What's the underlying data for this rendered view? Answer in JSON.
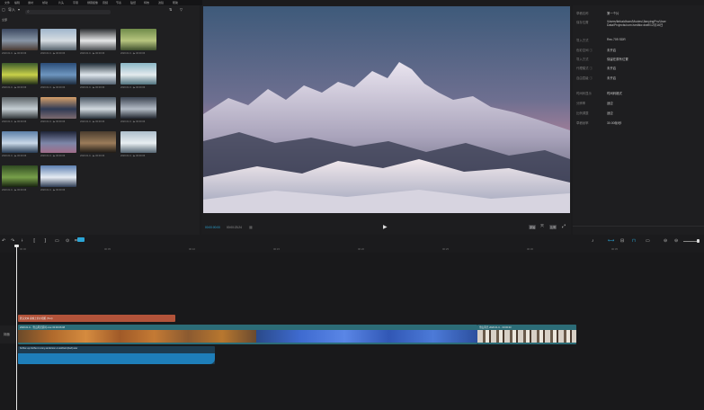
{
  "menu": {
    "items": [
      "文件",
      "编辑",
      "素材",
      "帧动",
      "片头",
      "字幕",
      "绿幕抠像",
      "音频",
      "节奏",
      "贴纸",
      "特效",
      "滤镜",
      "帮助"
    ]
  },
  "media": {
    "import_label": "导入",
    "tag_label": "全部",
    "clips": [
      {
        "caption": "2020.01.0... ▶ 00:00:06",
        "colors": [
          "#3b4860",
          "#8895a6",
          "#4a3a32"
        ]
      },
      {
        "caption": "2020.01.0... ▶ 00:00:06",
        "colors": [
          "#9fb6cc",
          "#d7dde2",
          "#55616b"
        ]
      },
      {
        "caption": "2020.01.0... ▶ 00:00:06",
        "colors": [
          "#2c2e31",
          "#e6e7e8",
          "#4b4f52"
        ]
      },
      {
        "caption": "2020.01.0... ▶ 00:00:06",
        "colors": [
          "#6f8b4a",
          "#b7c57f",
          "#3e4f2d"
        ]
      },
      {
        "caption": "2020.01.0... ▶ 00:00:06",
        "colors": [
          "#3c5a2c",
          "#c9d14a",
          "#1f2c18"
        ]
      },
      {
        "caption": "2020.01.0... ▶ 00:00:06",
        "colors": [
          "#2a4c77",
          "#6e96bf",
          "#1d2c3e"
        ]
      },
      {
        "caption": "2020.01.0... ▶ 00:00:06",
        "colors": [
          "#1e2b35",
          "#dfe6ec",
          "#526170"
        ]
      },
      {
        "caption": "2020.01.0... ▶ 00:00:06",
        "colors": [
          "#8bb7c6",
          "#e4ebee",
          "#50737f"
        ]
      },
      {
        "caption": "2020.01.0... ▶ 00:00:06",
        "colors": [
          "#5c6367",
          "#c6cfd4",
          "#2f3437"
        ]
      },
      {
        "caption": "2020.01.0... ▶ 00:00:06",
        "colors": [
          "#d6a06a",
          "#2f3a55",
          "#7d6b70"
        ]
      },
      {
        "caption": "2020.01.0... ▶ 00:00:06",
        "colors": [
          "#4a5663",
          "#d3dae0",
          "#27313a"
        ]
      },
      {
        "caption": "2020.01.0... ▶ 00:00:06",
        "colors": [
          "#3a4250",
          "#b4bcc6",
          "#1e232b"
        ]
      },
      {
        "caption": "2020.01.0... ▶ 00:00:06",
        "colors": [
          "#5b7fa6",
          "#c9d8e8",
          "#263a52"
        ]
      },
      {
        "caption": "2020.01.0... ▶ 00:00:06",
        "colors": [
          "#1e2437",
          "#7d86a8",
          "#a06d8a"
        ]
      },
      {
        "caption": "2020.01.0... ▶ 00:00:06",
        "colors": [
          "#4b3d2f",
          "#9b7c5a",
          "#1e1a15"
        ]
      },
      {
        "caption": "2020.01.0... ▶ 00:00:06",
        "colors": [
          "#aebfcc",
          "#e8eef1",
          "#566673"
        ]
      },
      {
        "caption": "2020.01.0... ▶ 00:00:06",
        "colors": [
          "#2f4a22",
          "#78a04a",
          "#15210f"
        ]
      },
      {
        "caption": "2020.01.0... ▶ 00:00:06",
        "colors": [
          "#5d7fb0",
          "#e6ecf3",
          "#2c3a52"
        ]
      }
    ]
  },
  "preview": {
    "current_time": "00:00:00:00",
    "total_time": "00:00:23:24",
    "ratio_label": "原始",
    "fit_label": "比例"
  },
  "inspector": {
    "rows": [
      {
        "label": "草稿名称",
        "value": "第一个片"
      },
      {
        "label": "保存位置",
        "value": "/Users/tiebaidhom/Movies/JianyingPro/User Data/Projects/com.lveditor.draft/12月16日"
      },
      {
        "label": "",
        "value": ""
      },
      {
        "label": "导入方式",
        "value": "Rec.709 SDR"
      },
      {
        "label": "色彩空间 ⓘ",
        "value": "未开启"
      },
      {
        "label": "导入方式",
        "value": "保留在原有位置"
      },
      {
        "label": "代理模式 ⓘ",
        "value": "未开启"
      },
      {
        "label": "自由层级 ⓘ",
        "value": "未开启"
      },
      {
        "label": "",
        "value": ""
      },
      {
        "label": "时间码显示",
        "value": "时间码格式"
      },
      {
        "label": "分辨率",
        "value": "适应"
      },
      {
        "label": "比例调整",
        "value": "适应"
      },
      {
        "label": "草稿帧率",
        "value": "30.00帧/秒"
      }
    ]
  },
  "timeline": {
    "ruler_labels": [
      "00:00",
      "00:05",
      "00:10",
      "00:15",
      "00:20",
      "00:25",
      "00:30",
      "00:35"
    ],
    "track_label": "封面",
    "text_clip": "默认文本 春晚上的小姐姐 (Text)",
    "video_clip_1": "2020.01.0... 雪山风光延时.mov 00:00:06:08",
    "video_clip_2": "雪山风光 2020.01.0... 00:00:03",
    "audio_clip": "further-up-further-in-tony-anderson-musicbed-(bed).wav"
  },
  "colors": {
    "accent": "#2ba5d6",
    "text_clip": "#b2533a",
    "video_track": "#2c6c77",
    "audio_track": "#1e7eb9"
  }
}
